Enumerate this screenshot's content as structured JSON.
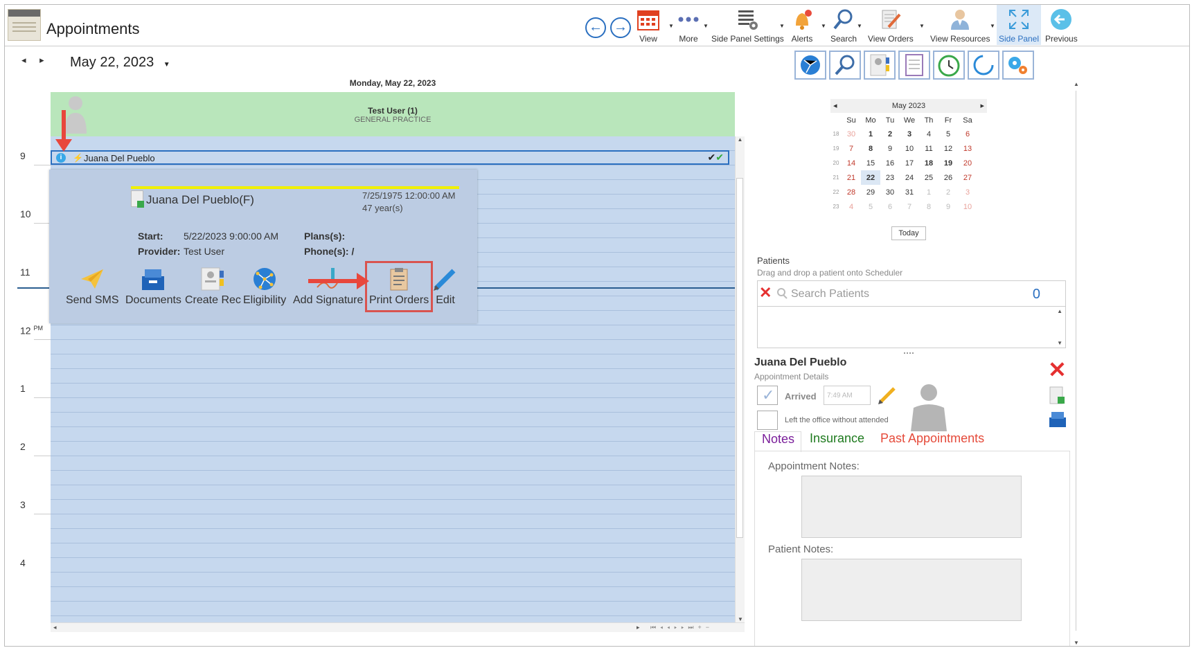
{
  "header": {
    "title": "Appointments"
  },
  "toolbar": {
    "view": "View",
    "more": "More",
    "side_panel_settings": "Side Panel Settings",
    "alerts": "Alerts",
    "search": "Search",
    "view_orders": "View Orders",
    "view_resources": "View Resources",
    "side_panel": "Side Panel",
    "previous": "Previous"
  },
  "scheduler": {
    "date": "May 22, 2023",
    "day_header": "Monday, May 22, 2023",
    "resource_name": "Test User (1)",
    "resource_sub": "GENERAL PRACTICE",
    "hours": [
      "9",
      "10",
      "11",
      "12",
      "1",
      "2",
      "3",
      "4"
    ],
    "pm_label": "PM",
    "appointment": {
      "patient": "Juana Del Pueblo",
      "info": "i"
    }
  },
  "popup": {
    "name": "Juana Del Pueblo(F)",
    "dob": "7/25/1975 12:00:00 AM",
    "age": "47 year(s)",
    "start_label": "Start:",
    "start_value": "5/22/2023 9:00:00 AM",
    "provider_label": "Provider:",
    "provider_value": "Test User",
    "plans_label": "Plans(s):",
    "phone_label": "Phone(s): /",
    "actions": [
      "Send SMS",
      "Documents",
      "Create Rec",
      "Eligibility",
      "Add Signature",
      "Print Orders",
      "Edit"
    ]
  },
  "calendar": {
    "month": "May 2023",
    "days": [
      "Su",
      "Mo",
      "Tu",
      "We",
      "Th",
      "Fr",
      "Sa"
    ],
    "weeks": [
      "18",
      "19",
      "20",
      "21",
      "22",
      "23"
    ],
    "rows": [
      [
        "30",
        "1",
        "2",
        "3",
        "4",
        "5",
        "6"
      ],
      [
        "7",
        "8",
        "9",
        "10",
        "11",
        "12",
        "13"
      ],
      [
        "14",
        "15",
        "16",
        "17",
        "18",
        "19",
        "20"
      ],
      [
        "21",
        "22",
        "23",
        "24",
        "25",
        "26",
        "27"
      ],
      [
        "28",
        "29",
        "30",
        "31",
        "1",
        "2",
        "3"
      ],
      [
        "4",
        "5",
        "6",
        "7",
        "8",
        "9",
        "10"
      ]
    ],
    "today": "Today"
  },
  "patients": {
    "title": "Patients",
    "subtitle": "Drag and drop a patient onto Scheduler",
    "search_placeholder": "Search Patients",
    "count": "0"
  },
  "details": {
    "patient": "Juana Del Pueblo",
    "subtitle": "Appointment Details",
    "arrived": "Arrived",
    "arrived_time": "7:49 AM",
    "left_office": "Left the office without attended",
    "tabs": [
      "Notes",
      "Insurance",
      "Past Appointments"
    ],
    "appointment_notes": "Appointment Notes:",
    "patient_notes": "Patient Notes:"
  },
  "colors": {
    "accent": "#2a6fc0",
    "resource": "#b9e6bb",
    "grid": "#c6d8ee",
    "highlight": "#d9534f"
  }
}
